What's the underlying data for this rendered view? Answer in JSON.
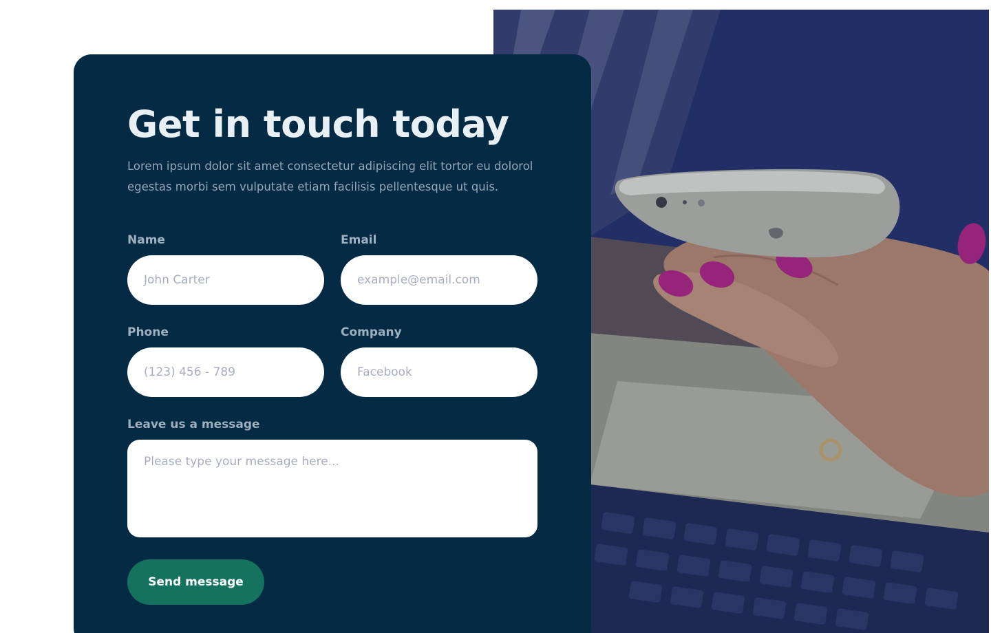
{
  "hero": {
    "title": "Get in touch today",
    "description": "Lorem ipsum dolor sit amet consectetur adipiscing elit tortor eu dolorol egestas morbi sem vulputate etiam facilisis pellentesque ut quis."
  },
  "form": {
    "name": {
      "label": "Name",
      "placeholder": "John Carter"
    },
    "email": {
      "label": "Email",
      "placeholder": "example@email.com"
    },
    "phone": {
      "label": "Phone",
      "placeholder": "(123) 456 - 789"
    },
    "company": {
      "label": "Company",
      "placeholder": "Facebook"
    },
    "message": {
      "label": "Leave us a message",
      "placeholder": "Please type your message here..."
    },
    "submit_label": "Send message"
  },
  "colors": {
    "card_background": "#042a44",
    "button_background": "#14725f",
    "page_background": "#ffffff"
  }
}
